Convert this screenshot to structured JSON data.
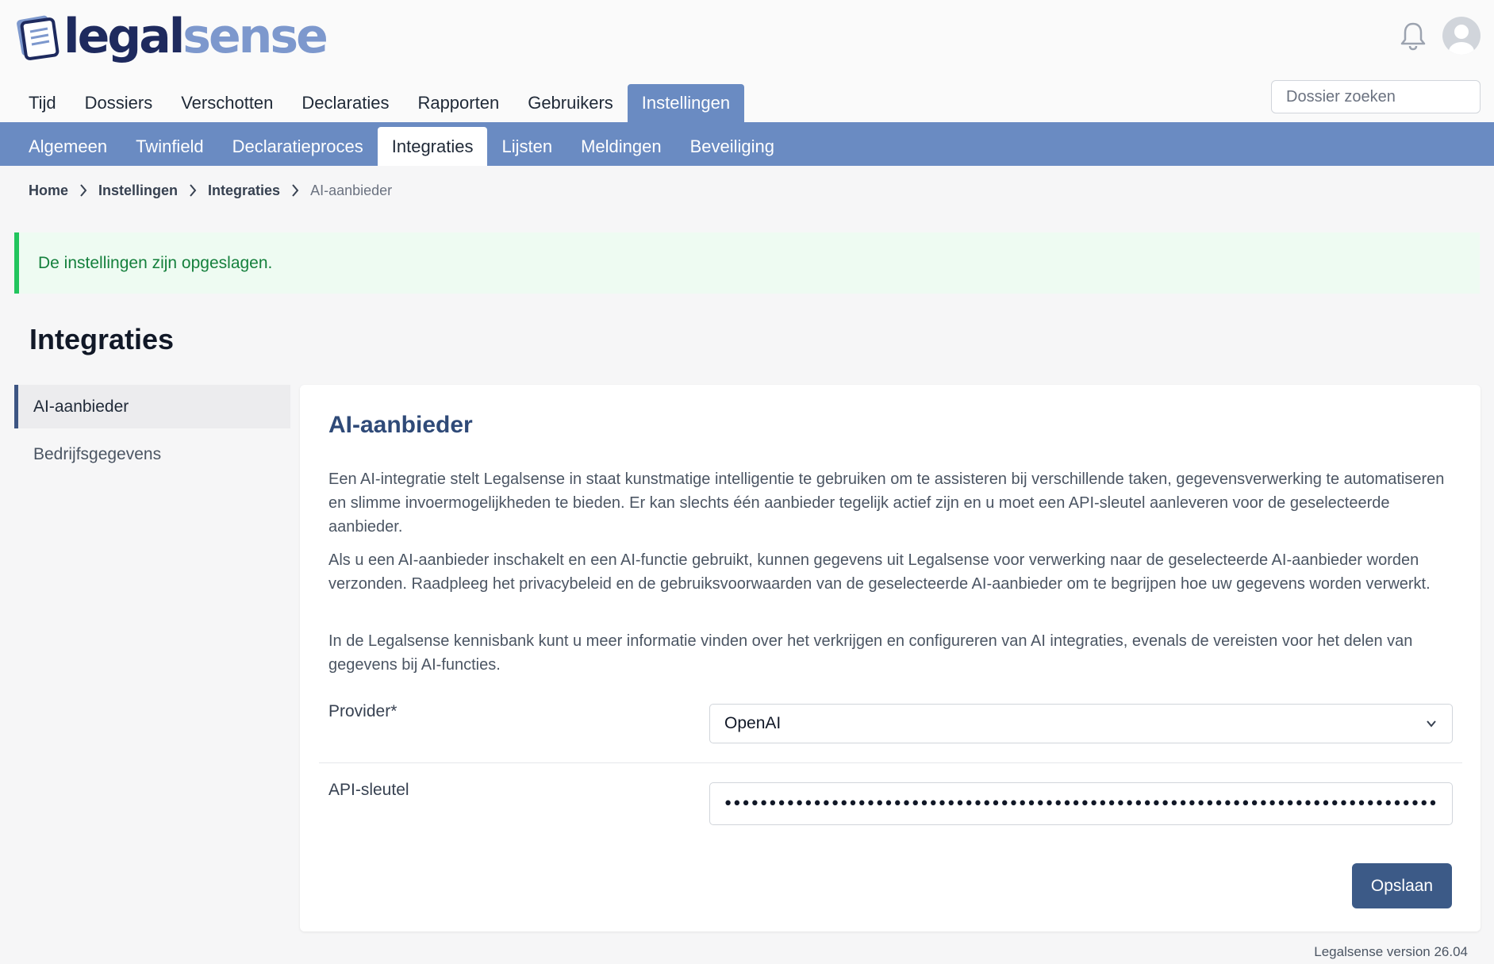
{
  "brand": {
    "name_part1": "legal",
    "name_part2": "sense",
    "color_primary": "#1e2a5e",
    "color_secondary": "#7d98cd"
  },
  "header": {
    "notification_icon": "bell-icon",
    "avatar_icon": "user-avatar-icon",
    "search_placeholder": "Dossier zoeken"
  },
  "main_nav": [
    {
      "label": "Tijd",
      "active": false
    },
    {
      "label": "Dossiers",
      "active": false
    },
    {
      "label": "Verschotten",
      "active": false
    },
    {
      "label": "Declaraties",
      "active": false
    },
    {
      "label": "Rapporten",
      "active": false
    },
    {
      "label": "Gebruikers",
      "active": false
    },
    {
      "label": "Instellingen",
      "active": true
    }
  ],
  "sub_nav": [
    {
      "label": "Algemeen",
      "active": false
    },
    {
      "label": "Twinfield",
      "active": false
    },
    {
      "label": "Declaratieproces",
      "active": false
    },
    {
      "label": "Integraties",
      "active": true
    },
    {
      "label": "Lijsten",
      "active": false
    },
    {
      "label": "Meldingen",
      "active": false
    },
    {
      "label": "Beveiliging",
      "active": false
    }
  ],
  "breadcrumb": [
    "Home",
    "Instellingen",
    "Integraties",
    "AI-aanbieder"
  ],
  "alert": {
    "message": "De instellingen zijn opgeslagen.",
    "type": "success",
    "color": "#22c55e"
  },
  "page_title": "Integraties",
  "side_menu": [
    {
      "label": "AI-aanbieder",
      "active": true
    },
    {
      "label": "Bedrijfsgegevens",
      "active": false
    }
  ],
  "card": {
    "title": "AI-aanbieder",
    "paragraphs": [
      "Een AI-integratie stelt Legalsense in staat kunstmatige intelligentie te gebruiken om te assisteren bij verschillende taken, gegevensverwerking te automatiseren en slimme invoermogelijkheden te bieden. Er kan slechts één aanbieder tegelijk actief zijn en u moet een API-sleutel aanleveren voor de geselecteerde aanbieder.",
      "Als u een AI-aanbieder inschakelt en een AI-functie gebruikt, kunnen gegevens uit Legalsense voor verwerking naar de geselecteerde AI-aanbieder worden verzonden. Raadpleeg het privacybeleid en de gebruiksvoorwaarden van de geselecteerde AI-aanbieder om te begrijpen hoe uw gegevens worden verwerkt.",
      "In de Legalsense kennisbank kunt u meer informatie vinden over het verkrijgen en configureren van AI integraties, evenals de vereisten voor het delen van gegevens bij AI-functies."
    ],
    "provider_label": "Provider*",
    "provider_value": "OpenAI",
    "api_key_label": "API-sleutel",
    "api_key_value": "••••••••••••••••••••••••••••••••••••••••••••••••••••••••••••••••••••••••••••••••",
    "save_label": "Opslaan"
  },
  "footer": {
    "version": "Legalsense version 26.04"
  },
  "colors": {
    "nav_accent": "#6a8bc2",
    "button": "#3c5a87",
    "card_title": "#2f4a78"
  }
}
